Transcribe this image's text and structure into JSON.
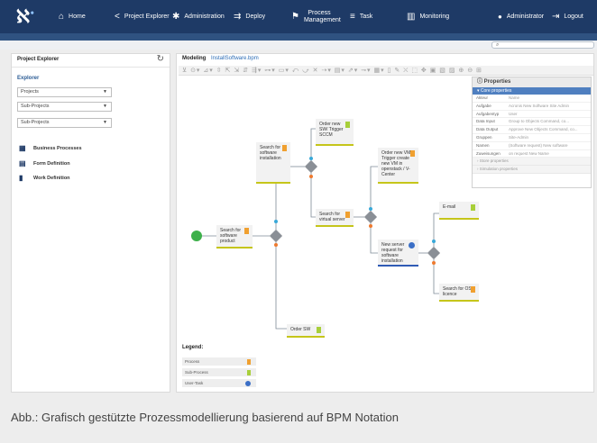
{
  "header": {
    "logo": "ℵ",
    "nav": [
      {
        "label": "Home",
        "icon": "home-icon",
        "glyph": "⌂"
      },
      {
        "label": "Project Explorer",
        "icon": "share-icon",
        "glyph": "<"
      },
      {
        "label": "Administration",
        "icon": "gear-icon",
        "glyph": "✱"
      },
      {
        "label": "Deploy",
        "icon": "deploy-icon",
        "glyph": "⇉"
      },
      {
        "label": "Process Management",
        "icon": "process-icon",
        "glyph": "⚑"
      },
      {
        "label": "Task",
        "icon": "list-icon",
        "glyph": "≡"
      },
      {
        "label": "Monitoring",
        "icon": "bar-chart-icon",
        "glyph": "▥"
      }
    ],
    "user": {
      "label": "Administrator",
      "icon": "user-icon",
      "glyph": "●"
    },
    "logout": {
      "label": "Logout",
      "icon": "logout-icon",
      "glyph": "⇥"
    }
  },
  "search": {
    "icon": "search-icon",
    "glyph": "⌕"
  },
  "left_panel": {
    "title": "Project Explorer",
    "explorer_label": "Explorer",
    "selects": [
      "Projects",
      "Sub-Projects",
      "Sub-Projects"
    ],
    "definitions": [
      {
        "label": "Business Processes",
        "icon": "building-icon",
        "glyph": "▦"
      },
      {
        "label": "Form Definition",
        "icon": "form-icon",
        "glyph": "▤"
      },
      {
        "label": "Work Definition",
        "icon": "document-icon",
        "glyph": "▮"
      }
    ]
  },
  "modeler": {
    "tab_label": "Modeling",
    "file_name": "InstallSoftware.bpm",
    "toolbar": "⊻ ⊙▾ ⊿▾ ⇳ ⇱ ⇲ ⇵ ⇶▾ ⊶▾ ▭▾ ⤺ ⤻ ✕ ⇢▾ ▤▾ ⇗▾ ⊸▾ ▦▾ ▯ ✎ ⛌ ⬚ ✥ ▣ ▧ ▨ ⊕ ⊖ ⊞",
    "properties": {
      "title": "Properties",
      "section": "Core properties",
      "rows": [
        {
          "k": "Akteur",
          "v": "Name"
        },
        {
          "k": "Aufgabe",
          "v": "Acronis New Software Site Admin"
        },
        {
          "k": "Aufgabentyp",
          "v": "User"
        },
        {
          "k": "Data Input",
          "v": "Group to Objects Command, co..."
        },
        {
          "k": "Data Output",
          "v": "Approve New Objects Command, co..."
        },
        {
          "k": "Gruppen",
          "v": "Site-Admin"
        },
        {
          "k": "Namen",
          "v": "(Software request) New software"
        },
        {
          "k": "Zuweisungen",
          "v": "on request New Name"
        }
      ],
      "collapsed": [
        "Store properties",
        "Simulation properties"
      ]
    },
    "nodes": {
      "search_product": "Search for software product",
      "search_installation": "Search for software installation",
      "order_trigger": "Order new SW/ Trigger SCCM",
      "search_virtual": "Search for virtual server",
      "order_vm": "Order new VM / Trigger create new VM in openstack / V-Center",
      "new_server": "New server request for software installation",
      "email": "E-mail",
      "search_os": "Search for OS licence",
      "order_sw": "Order SW"
    },
    "legend": {
      "title": "Legend:",
      "items": [
        {
          "label": "Process",
          "color": "#f0a030"
        },
        {
          "label": "Sub-Process",
          "color": "#a8cf3a"
        },
        {
          "label": "User-Task",
          "color": "#3b6fc6"
        }
      ]
    }
  },
  "caption": "Abb.: Grafisch gestützte Prozessmodellierung basierend auf BPM Notation",
  "colors": {
    "header": "#1e3a66",
    "accent": "#2a6bb5",
    "gateway": "#8a8f96",
    "start": "#3db04a"
  }
}
